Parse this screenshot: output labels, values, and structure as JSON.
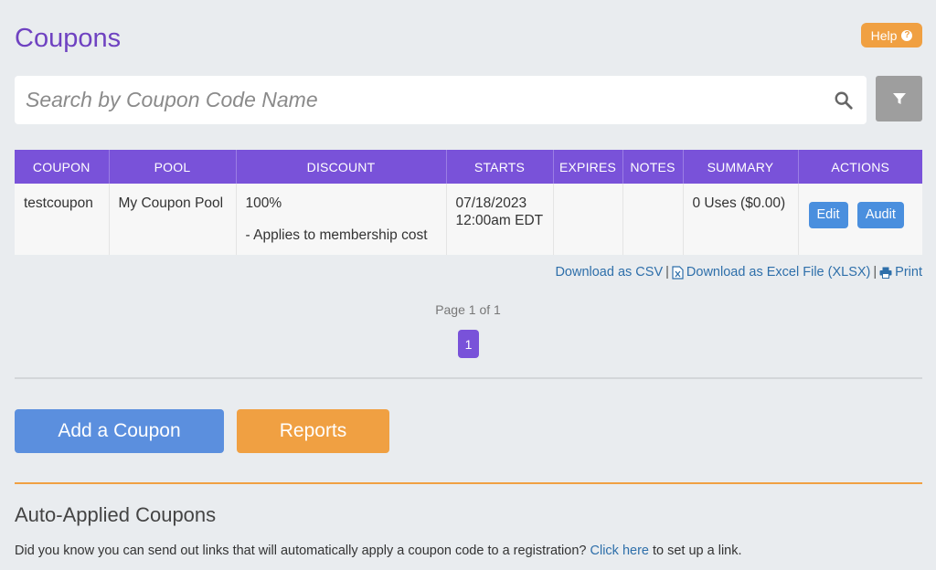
{
  "page": {
    "title": "Coupons"
  },
  "help": {
    "label": "Help"
  },
  "search": {
    "placeholder": "Search by Coupon Code Name",
    "value": ""
  },
  "table": {
    "headers": [
      "COUPON",
      "POOL",
      "DISCOUNT",
      "STARTS",
      "EXPIRES",
      "NOTES",
      "SUMMARY",
      "ACTIONS"
    ],
    "rows": [
      {
        "coupon": "testcoupon",
        "pool": "My Coupon Pool",
        "discount": "100%",
        "discount_note": "- Applies to membership cost",
        "starts_date": "07/18/2023",
        "starts_time": "12:00am EDT",
        "expires": "",
        "notes": "",
        "summary": "0 Uses ($0.00)",
        "actions": [
          "Edit",
          "Audit"
        ]
      }
    ]
  },
  "downloads": {
    "csv": "Download as CSV",
    "sep": "|",
    "excel": "Download as Excel File (XLSX)",
    "print": "Print"
  },
  "pager": {
    "text": "Page 1 of 1",
    "current": "1"
  },
  "buttons": {
    "add_coupon": "Add a Coupon",
    "reports": "Reports"
  },
  "auto_applied": {
    "title": "Auto-Applied Coupons",
    "text_before": "Did you know you can send out links that will automatically apply a coupon code to a registration? ",
    "link": "Click here",
    "text_after": " to set up a link."
  },
  "colors": {
    "accent_purple": "#7952d9",
    "title_purple": "#6f42c1",
    "orange": "#f0a042",
    "blue": "#5b8fde",
    "link": "#2e6faa"
  },
  "icons": [
    "help-circle-icon",
    "search-icon",
    "filter-icon",
    "excel-file-icon",
    "printer-icon"
  ]
}
